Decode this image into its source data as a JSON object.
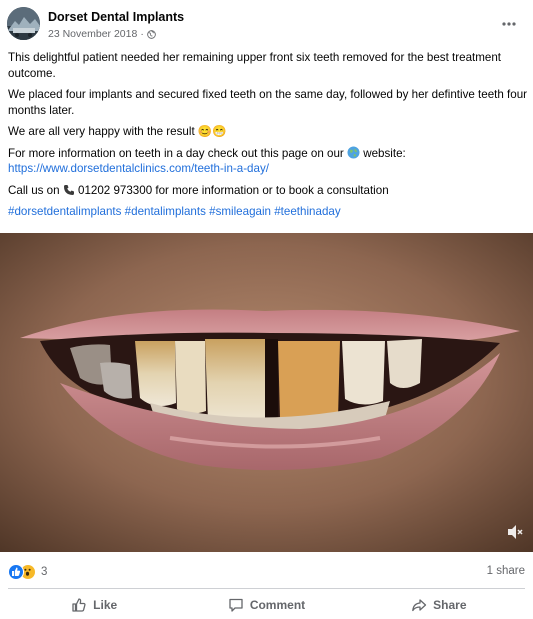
{
  "post": {
    "author": "Dorset Dental Implants",
    "date": "23 November 2018",
    "date_separator": "·",
    "paragraphs": {
      "p1": "This delightful patient needed her remaining upper front six teeth removed for the best treatment outcome.",
      "p2": "We placed four implants and secured fixed teeth on the same day, followed by her defintive teeth four months later.",
      "p3": "We are all very happy with the result 😊😁",
      "p4_before": "For more information on teeth in a day check out this page on our ",
      "p4_after": " website:",
      "p4_link": "https://www.dorsetdentalclinics.com/teeth-in-a-day/",
      "p5_before": "Call us on ",
      "p5_after": " 01202 973300 for more information or to book a consultation"
    },
    "hashtags": [
      "#dorsetdentalimplants",
      "#dentalimplants",
      "#smileagain",
      "#teethinaday"
    ]
  },
  "reactions": {
    "icons": [
      "like-reaction",
      "wow-reaction"
    ],
    "count": "3",
    "shares": "1 share"
  },
  "actions": {
    "like": "Like",
    "comment": "Comment",
    "share": "Share"
  },
  "colors": {
    "link": "#216fdb",
    "muted": "#65676b",
    "like_blue": "#1877f2",
    "wow_yellow": "#f7b928"
  }
}
